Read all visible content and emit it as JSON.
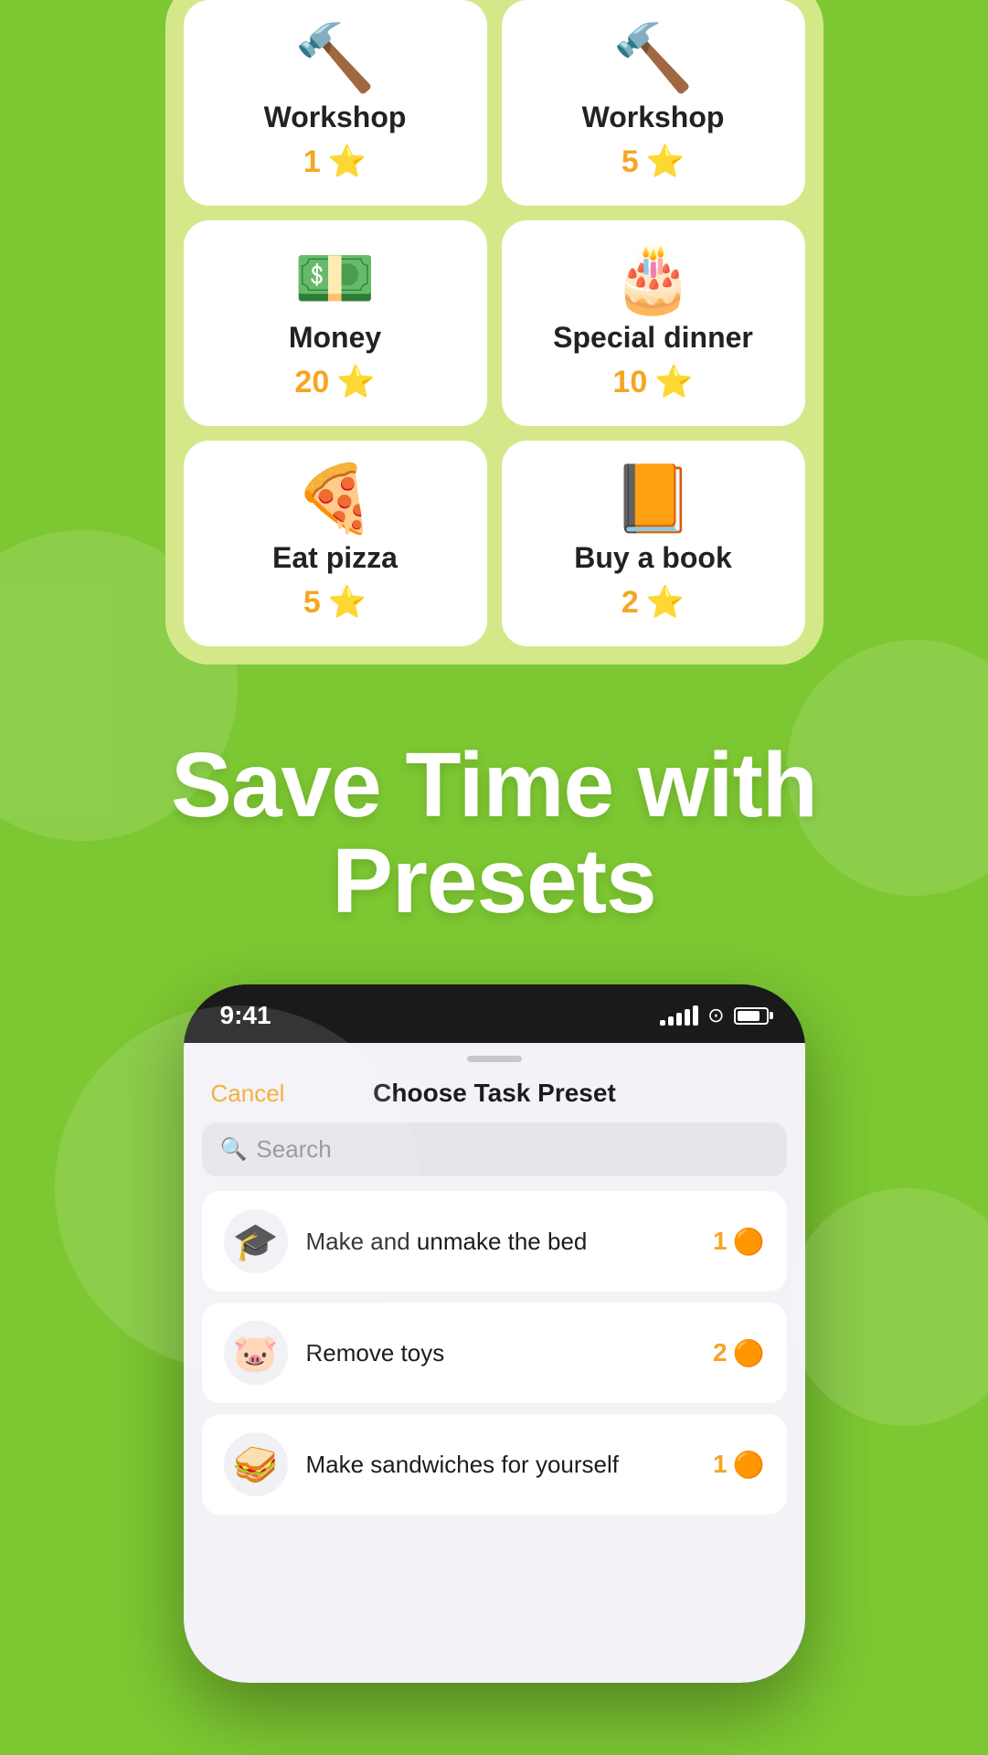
{
  "background_color": "#7dc832",
  "top_card": {
    "rewards": [
      {
        "id": "workshop1",
        "emoji": "🔨",
        "name": "Workshop",
        "points": "1"
      },
      {
        "id": "workshop5",
        "emoji": "🔨",
        "name": "Workshop",
        "points": "5"
      },
      {
        "id": "money20",
        "emoji": "💵",
        "name": "Money",
        "points": "20"
      },
      {
        "id": "special10",
        "emoji": "🎂",
        "name": "Special dinner",
        "points": "10"
      },
      {
        "id": "pizza5",
        "emoji": "🍕",
        "name": "Eat pizza",
        "points": "5"
      },
      {
        "id": "book2",
        "emoji": "📙",
        "name": "Buy a book",
        "points": "2"
      }
    ]
  },
  "headline": {
    "line1": "Save Time with",
    "line2": "Presets"
  },
  "phone": {
    "status_bar": {
      "time": "9:41",
      "signal_bars": [
        6,
        10,
        14,
        18,
        22
      ],
      "wifi": "WiFi",
      "battery": "Battery"
    },
    "modal": {
      "cancel_label": "Cancel",
      "title": "Choose Task Preset",
      "search_placeholder": "Search",
      "tasks": [
        {
          "id": "task1",
          "emoji": "🎓",
          "name": "Make and unmake the bed",
          "points": "1"
        },
        {
          "id": "task2",
          "emoji": "🐷",
          "name": "Remove toys",
          "points": "2"
        },
        {
          "id": "task3",
          "emoji": "🥪",
          "name": "Make sandwiches for yourself",
          "points": "1"
        }
      ]
    }
  }
}
